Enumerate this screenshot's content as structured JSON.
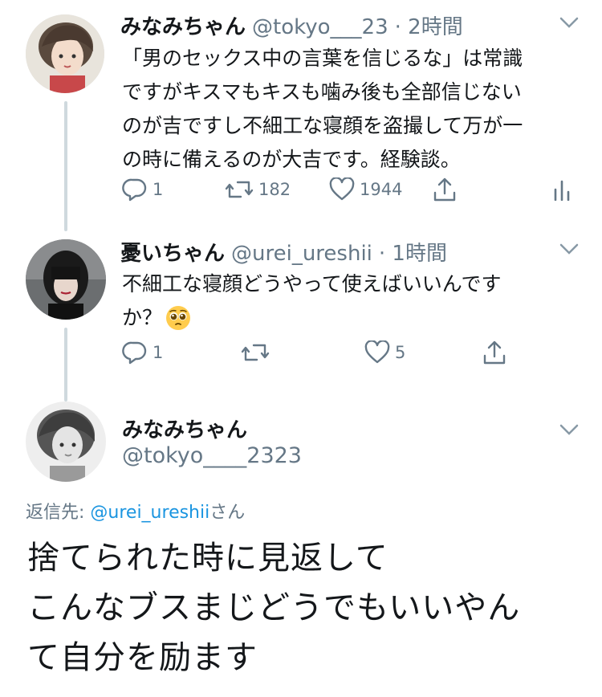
{
  "tweet1": {
    "name": "みなみちゃん",
    "handle": "@tokyo___23",
    "time": "· 2時間",
    "lines": [
      "「男のセックス中の言葉を信じるな」は常識",
      "ですがキスマもキスも噛み後も全部信じない",
      "のが吉ですし不細工な寝顔を盗撮して万が一",
      "の時に備えるのが大吉です。経験談。"
    ],
    "reply_count": "1",
    "retweet_count": "182",
    "like_count": "1944"
  },
  "tweet2": {
    "name": "憂いちゃん",
    "handle": "@urei_ureshii",
    "time": "· 1時間",
    "lines": [
      "不細工な寝顔どうやって使えばいいんです",
      "か？"
    ],
    "emoji": "🥺",
    "reply_count": "1",
    "like_count": "5"
  },
  "tweet3": {
    "name": "みなみちゃん",
    "handle": "@tokyo____2323",
    "reply_to_prefix": "返信先: ",
    "reply_to_handle": "@urei_ureshii",
    "reply_to_suffix": "さん",
    "lines": [
      "捨てられた時に見返して",
      "こんなブスまじどうでもいいやん",
      "て自分を励ます"
    ]
  },
  "icons": {
    "reply": "reply-icon",
    "retweet": "retweet-icon",
    "like": "heart-icon",
    "share": "share-icon",
    "analytics": "analytics-icon",
    "more": "chevron-down-icon"
  },
  "colors": {
    "text": "#14171a",
    "secondary": "#657786",
    "link": "#1b95e0",
    "thread_line": "#cfd9de"
  }
}
